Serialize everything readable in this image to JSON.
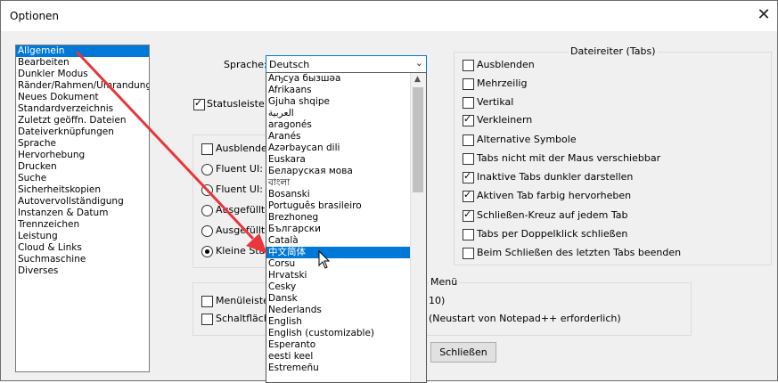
{
  "window": {
    "title": "Optionen",
    "close_glyph": "✕"
  },
  "categories": [
    {
      "label": "Allgemein",
      "selected": true
    },
    {
      "label": "Bearbeiten"
    },
    {
      "label": "Dunkler Modus"
    },
    {
      "label": "Ränder/Rahmen/Umrandungen"
    },
    {
      "label": "Neues Dokument"
    },
    {
      "label": "Standardverzeichnis"
    },
    {
      "label": "Zuletzt geöffn. Dateien"
    },
    {
      "label": "Dateiverknüpfungen"
    },
    {
      "label": "Sprache"
    },
    {
      "label": "Hervorhebung"
    },
    {
      "label": "Drucken"
    },
    {
      "label": "Suche"
    },
    {
      "label": "Sicherheitskopien"
    },
    {
      "label": "Autovervollständigung"
    },
    {
      "label": "Instanzen & Datum"
    },
    {
      "label": "Trennzeichen"
    },
    {
      "label": "Leistung"
    },
    {
      "label": "Cloud & Links"
    },
    {
      "label": "Suchmaschine"
    },
    {
      "label": "Diverses"
    }
  ],
  "language": {
    "label": "Sprache:",
    "selected": "Deutsch",
    "options": [
      {
        "label": "Аҧсуа бызшәа"
      },
      {
        "label": "Afrikaans"
      },
      {
        "label": "Gjuha shqipe"
      },
      {
        "label": "العربية"
      },
      {
        "label": "aragonés"
      },
      {
        "label": "Aranés"
      },
      {
        "label": "Azərbaycan dili"
      },
      {
        "label": "Euskara"
      },
      {
        "label": "Беларуская мова"
      },
      {
        "label": "বাংলা"
      },
      {
        "label": "Bosanski"
      },
      {
        "label": "Português brasileiro"
      },
      {
        "label": "Brezhoneg"
      },
      {
        "label": "Български"
      },
      {
        "label": "Català"
      },
      {
        "label": "中文简体",
        "selected": true
      },
      {
        "label": "Corsu"
      },
      {
        "label": "Hrvatski"
      },
      {
        "label": "Česky"
      },
      {
        "label": "Dansk"
      },
      {
        "label": "Nederlands"
      },
      {
        "label": "English"
      },
      {
        "label": "English (customizable)"
      },
      {
        "label": "Esperanto"
      },
      {
        "label": "eesti keel"
      },
      {
        "label": "Estremeñu"
      }
    ]
  },
  "statusbar": {
    "label": "Statusleiste a",
    "checked": true
  },
  "toolbar_group": {
    "hide_label": "Ausblenden",
    "radios": [
      {
        "label": "Fluent UI: kl",
        "checked": false
      },
      {
        "label": "Fluent UI: gr",
        "checked": false
      },
      {
        "label": "Ausgefüllte I",
        "checked": false
      },
      {
        "label": "Ausgefüllte I",
        "checked": false
      },
      {
        "label": "Kleine Stand",
        "checked": true
      }
    ]
  },
  "menu_group": {
    "title": "Menü",
    "menubar_label": "Menüleiste a",
    "menubar_suffix": "10)",
    "buttons_label": "Schaltfläche",
    "buttons_suffix": "(Neustart von Notepad++ erforderlich)"
  },
  "tabs_group": {
    "title": "Dateireiter (Tabs)",
    "options": [
      {
        "label": "Ausblenden",
        "checked": false
      },
      {
        "label": "Mehrzeilig",
        "checked": false
      },
      {
        "label": "Vertikal",
        "checked": false
      },
      {
        "label": "Verkleinern",
        "checked": true
      },
      {
        "label": "Alternative Symbole",
        "checked": false
      },
      {
        "label": "Tabs nicht mit der Maus verschiebbar",
        "checked": false
      },
      {
        "label": "Inaktive Tabs dunkler darstellen",
        "checked": true
      },
      {
        "label": "Aktiven Tab farbig hervorheben",
        "checked": true
      },
      {
        "label": "Schließen-Kreuz auf jedem Tab",
        "checked": true
      },
      {
        "label": "Tabs per Doppelklick schließen",
        "checked": false
      },
      {
        "label": "Beim Schließen des letzten Tabs beenden",
        "checked": false
      }
    ]
  },
  "footer": {
    "close_button": "Schließen"
  },
  "colors": {
    "selection": "#0078d7",
    "arrow": "#e8363a"
  }
}
